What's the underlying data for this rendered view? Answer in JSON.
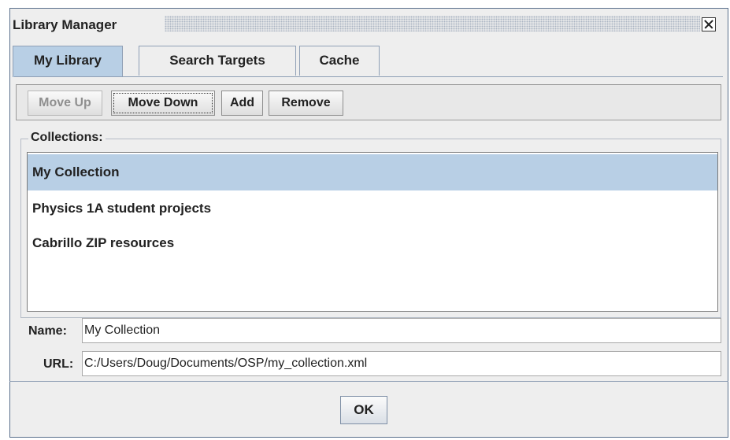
{
  "window": {
    "title": "Library Manager"
  },
  "tabs": [
    {
      "label": "My Library",
      "active": true
    },
    {
      "label": "Search Targets",
      "active": false
    },
    {
      "label": "Cache",
      "active": false
    }
  ],
  "toolbar": {
    "move_up": {
      "label": "Move Up",
      "enabled": false
    },
    "move_down": {
      "label": "Move Down",
      "enabled": true
    },
    "add": {
      "label": "Add",
      "enabled": true
    },
    "remove": {
      "label": "Remove",
      "enabled": true
    }
  },
  "collections": {
    "label": "Collections:",
    "items": [
      {
        "label": "My Collection",
        "selected": true
      },
      {
        "label": "Physics 1A student projects",
        "selected": false
      },
      {
        "label": "Cabrillo ZIP resources",
        "selected": false
      }
    ]
  },
  "fields": {
    "name": {
      "label": "Name:",
      "value": "My Collection"
    },
    "url": {
      "label": "URL:",
      "value": "C:/Users/Doug/Documents/OSP/my_collection.xml"
    }
  },
  "footer": {
    "ok_label": "OK"
  },
  "colors": {
    "selection": "#b8cfe5",
    "border": "#5a6f8c"
  }
}
